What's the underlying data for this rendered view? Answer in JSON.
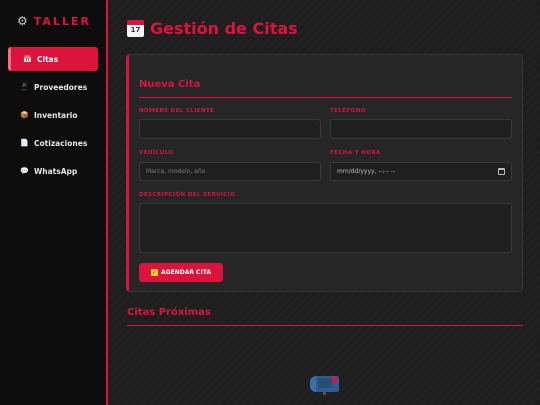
{
  "brand": {
    "name": "TALLER",
    "icon": "gear-icon"
  },
  "sidebar": {
    "items": [
      {
        "label": "Citas",
        "icon": "calendar-icon",
        "active": true
      },
      {
        "label": "Proveedores",
        "icon": "phone-icon",
        "active": false
      },
      {
        "label": "Inventario",
        "icon": "box-icon",
        "active": false
      },
      {
        "label": "Cotizaciones",
        "icon": "document-icon",
        "active": false
      },
      {
        "label": "WhatsApp",
        "icon": "chat-icon",
        "active": false
      }
    ]
  },
  "header": {
    "title": "Gestión de Citas",
    "icon": "calendar-icon",
    "icon_text": "17"
  },
  "form": {
    "title": "Nueva Cita",
    "client_label": "NOMBRE DEL CLIENTE",
    "client_value": "",
    "phone_label": "TELÉFONO",
    "phone_value": "",
    "vehicle_label": "VEHÍCULO",
    "vehicle_placeholder": "Marca, modelo, año",
    "datetime_label": "FECHA Y HORA",
    "datetime_value": "mm/dd/yyyy, --:-- --",
    "description_label": "DESCRIPCIÓN DEL SERVICIO",
    "description_value": "",
    "submit_label": "AGENDAR CITA",
    "submit_icon": "check-icon"
  },
  "upcoming": {
    "title": "Citas Próximas",
    "empty_icon": "mailbox-icon"
  },
  "colors": {
    "accent": "#dc143c",
    "sidebar_bg": "#0d0d0d",
    "main_bg": "#1e1e1e",
    "card_bg": "#262626"
  }
}
